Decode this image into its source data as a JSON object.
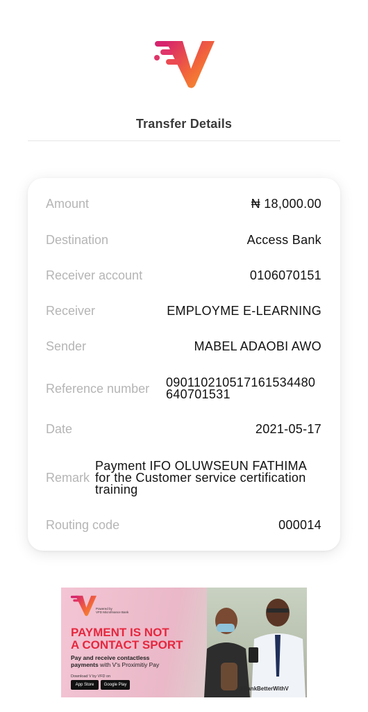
{
  "brand": {
    "logo_icon": "v-logo-icon",
    "colors": {
      "magenta": "#d6246e",
      "orange": "#f2653a",
      "yellow": "#f59b2b"
    }
  },
  "header": {
    "title": "Transfer Details"
  },
  "details": [
    {
      "label": "Amount",
      "value": "₦ 18,000.00"
    },
    {
      "label": "Destination",
      "value": "Access Bank"
    },
    {
      "label": "Receiver account",
      "value": "0106070151"
    },
    {
      "label": "Receiver",
      "value": "EMPLOYME E-LEARNING"
    },
    {
      "label": "Sender",
      "value": "MABEL ADAOBI AWO"
    },
    {
      "label": "Reference number",
      "value": "090110210517161534480 640701531"
    },
    {
      "label": "Date",
      "value": "2021-05-17"
    },
    {
      "label": "Remark",
      "value": "Payment IFO OLUWSEUN FATHIMA for the Customer service certification training"
    },
    {
      "label": "Routing code",
      "value": "000014"
    }
  ],
  "banner": {
    "powered_by": "Powered by",
    "bank_name": "VFD Microfinance Bank",
    "headline_line1": "PAYMENT IS NOT",
    "headline_line2": "A CONTACT SPORT",
    "subtext_bold": "Pay and receive contactless payments",
    "subtext_rest": " with V's Proximitiy Pay",
    "download_text": "Download V by VFD on",
    "app_store": "App Store",
    "google_play": "Google Play",
    "hashtag": "#BankBetterWithV"
  }
}
